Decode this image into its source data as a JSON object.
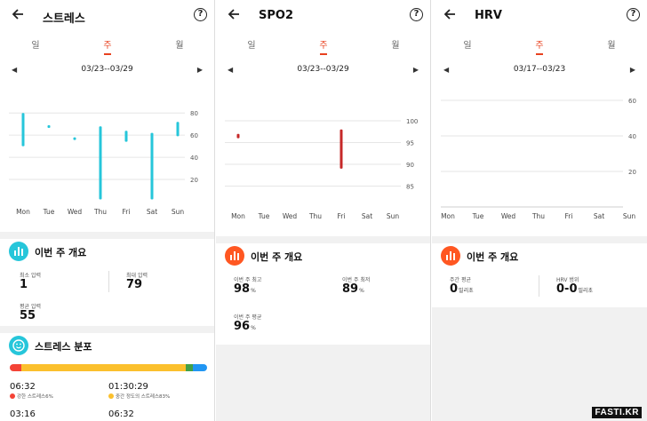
{
  "colors": {
    "stress": "#26c6da",
    "spo2": "#c62828",
    "accent": "#e8411f",
    "icon_orange": "#ff5722"
  },
  "stress": {
    "title": "스트레스",
    "tabs": [
      "일",
      "주",
      "월"
    ],
    "range": "03/23--03/29",
    "chart_data": {
      "type": "range-bar",
      "categories": [
        "Mon",
        "Tue",
        "Wed",
        "Thu",
        "Fri",
        "Sat",
        "Sun"
      ],
      "ranges": [
        [
          50,
          80
        ],
        [
          68,
          69
        ],
        [
          58,
          58
        ],
        [
          2,
          68
        ],
        [
          54,
          64
        ],
        [
          2,
          62
        ],
        [
          59,
          72
        ]
      ],
      "yticks": [
        20,
        40,
        60,
        80
      ],
      "ylim": [
        0,
        85
      ]
    },
    "overview": {
      "title": "이번 주 개요",
      "min_label": "최소 압력",
      "min_value": "1",
      "max_label": "최대 압력",
      "max_value": "79",
      "avg_label": "평균 압력",
      "avg_value": "55"
    },
    "distribution": {
      "title": "스트레스 분포",
      "segments": [
        {
          "color": "#f44336",
          "pct": 6
        },
        {
          "color": "#fbc02d",
          "pct": 83
        },
        {
          "color": "#43a047",
          "pct": 4
        },
        {
          "color": "#2196f3",
          "pct": 7
        }
      ],
      "item1_time": "06:32",
      "item1_label": "강한 스트레스6%",
      "item2_time": "01:30:29",
      "item2_label": "중간 정도의 스트레스83%",
      "item3_time": "03:16",
      "item4_time": "06:32"
    }
  },
  "spo2": {
    "title": "SPO2",
    "tabs": [
      "일",
      "주",
      "월"
    ],
    "range": "03/23--03/29",
    "chart_data": {
      "type": "range-bar",
      "categories": [
        "Mon",
        "Tue",
        "Wed",
        "Thu",
        "Fri",
        "Sat",
        "Sun"
      ],
      "ranges": [
        [
          96,
          97
        ],
        null,
        null,
        null,
        [
          89,
          98
        ],
        null,
        null
      ],
      "yticks": [
        85,
        90,
        95,
        100
      ],
      "ylim": [
        80,
        100
      ]
    },
    "overview": {
      "title": "이번 주 개요",
      "high_label": "이번 주 최고",
      "high_value": "98",
      "low_label": "이번 주 최저",
      "low_value": "89",
      "avg_label": "이번 주 평균",
      "avg_value": "96",
      "unit": "%"
    }
  },
  "hrv": {
    "title": "HRV",
    "tabs": [
      "일",
      "주",
      "월"
    ],
    "range": "03/17--03/23",
    "chart_data": {
      "type": "bar",
      "categories": [
        "Mon",
        "Tue",
        "Wed",
        "Thu",
        "Fri",
        "Sat",
        "Sun"
      ],
      "values": [],
      "yticks": [
        20,
        40,
        60
      ],
      "ylim": [
        0,
        60
      ]
    },
    "overview": {
      "title": "이번 주 개요",
      "avg_label": "주간 평균",
      "avg_value": "0",
      "range_label": "HRV 범위",
      "range_value": "0-0",
      "unit": "밀리초"
    }
  },
  "watermark": "FASTI.KR"
}
